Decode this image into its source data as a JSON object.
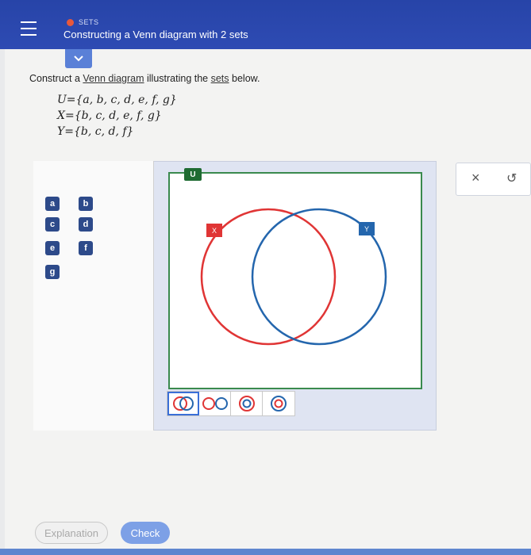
{
  "header": {
    "topic": "SETS",
    "title": "Constructing a Venn diagram with 2 sets",
    "accent_color": "#2e4bb3",
    "topic_dot_color": "#e8583a"
  },
  "instruction": {
    "prefix": "Construct a ",
    "link1": "Venn diagram",
    "middle": " illustrating the ",
    "link2": "sets",
    "suffix": " below."
  },
  "sets": {
    "u": "U={a, b, c, d, e, f, g}",
    "x": "X={b, c, d, e, f, g}",
    "y": "Y={b, c, d, f}"
  },
  "palette": {
    "elements": [
      "a",
      "b",
      "c",
      "d",
      "e",
      "f",
      "g"
    ]
  },
  "diagram": {
    "universe_label": "U",
    "set_x_label": "X",
    "set_y_label": "Y",
    "set_x_color": "#e03535",
    "set_y_color": "#2466ad",
    "universe_color": "#3a8a4e"
  },
  "region_tools": [
    "two-overlapping-circles",
    "two-separate-circles",
    "circle-y-inside-x",
    "circle-x-inside-y"
  ],
  "tools": {
    "clear": "×",
    "undo": "↺"
  },
  "buttons": {
    "explanation": "Explanation",
    "check": "Check"
  }
}
